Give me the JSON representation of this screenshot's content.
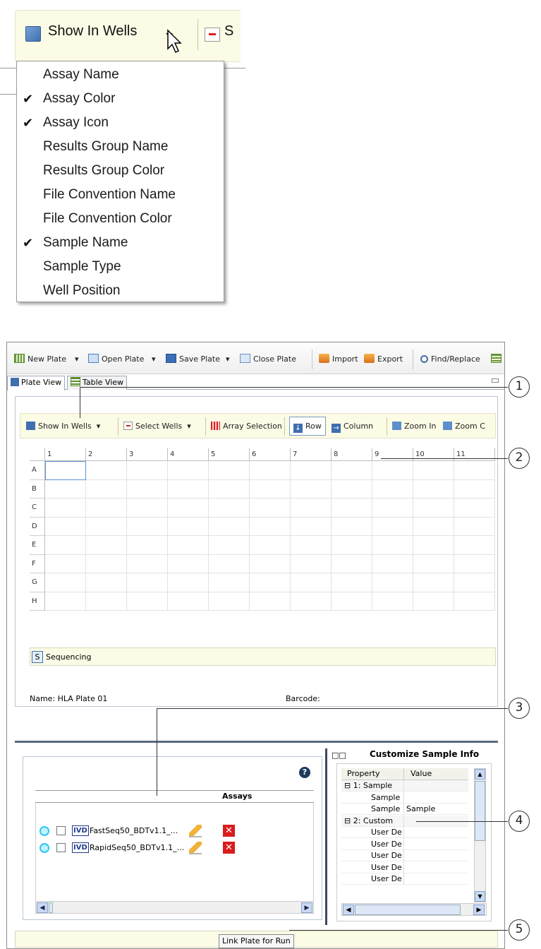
{
  "dropdown": {
    "button_label": "Show In Wells",
    "next_button_partial": "S",
    "items": [
      {
        "label": "Assay Name",
        "checked": false
      },
      {
        "label": "Assay Color",
        "checked": true
      },
      {
        "label": "Assay Icon",
        "checked": true
      },
      {
        "label": "Results Group Name",
        "checked": false
      },
      {
        "label": "Results Group Color",
        "checked": false
      },
      {
        "label": "File Convention Name",
        "checked": false
      },
      {
        "label": "File Convention Color",
        "checked": false
      },
      {
        "label": "Sample Name",
        "checked": true
      },
      {
        "label": "Sample Type",
        "checked": false
      },
      {
        "label": "Well Position",
        "checked": false
      }
    ]
  },
  "toolbar": {
    "new_plate": "New Plate",
    "open_plate": "Open Plate",
    "save_plate": "Save Plate",
    "close_plate": "Close Plate",
    "import": "Import",
    "export": "Export",
    "find_replace": "Find/Replace"
  },
  "tabs": {
    "plate_view": "Plate View",
    "table_view": "Table View"
  },
  "plate_toolbar": {
    "show_in_wells": "Show In Wells",
    "select_wells": "Select Wells",
    "array_selection": "Array Selection",
    "row": "Row",
    "column": "Column",
    "zoom_in": "Zoom In",
    "zoom_out_partial": "Zoom C"
  },
  "grid": {
    "columns": [
      "1",
      "2",
      "3",
      "4",
      "5",
      "6",
      "7",
      "8",
      "9",
      "10",
      "11"
    ],
    "rows": [
      "A",
      "B",
      "C",
      "D",
      "E",
      "F",
      "G",
      "H"
    ]
  },
  "sequencing": {
    "badge": "S",
    "label": "Sequencing"
  },
  "plate_info": {
    "name": "Name: HLA Plate 01",
    "barcode": "Barcode:"
  },
  "assays": {
    "header": "Assays",
    "rows": [
      {
        "badge": "IVD",
        "name": "FastSeq50_BDTv1.1_..."
      },
      {
        "badge": "IVD",
        "name": "RapidSeq50_BDTv1.1_..."
      }
    ]
  },
  "customize": {
    "title": "Customize Sample Info",
    "col_property": "Property",
    "col_value": "Value",
    "rows": [
      {
        "property": "⊟ 1: Sample",
        "value": "",
        "indent": false
      },
      {
        "property": "Sample N",
        "value": "",
        "indent": true
      },
      {
        "property": "Sample T",
        "value": "Sample",
        "indent": true
      },
      {
        "property": "⊟ 2: Custom",
        "value": "",
        "indent": false
      },
      {
        "property": "User Def",
        "value": "",
        "indent": true
      },
      {
        "property": "User Def",
        "value": "",
        "indent": true
      },
      {
        "property": "User Def",
        "value": "",
        "indent": true
      },
      {
        "property": "User Def",
        "value": "",
        "indent": true
      },
      {
        "property": "User Def",
        "value": "",
        "indent": true
      }
    ]
  },
  "link_button": "Link Plate for Run",
  "callouts": [
    "1",
    "2",
    "3",
    "4",
    "5"
  ]
}
